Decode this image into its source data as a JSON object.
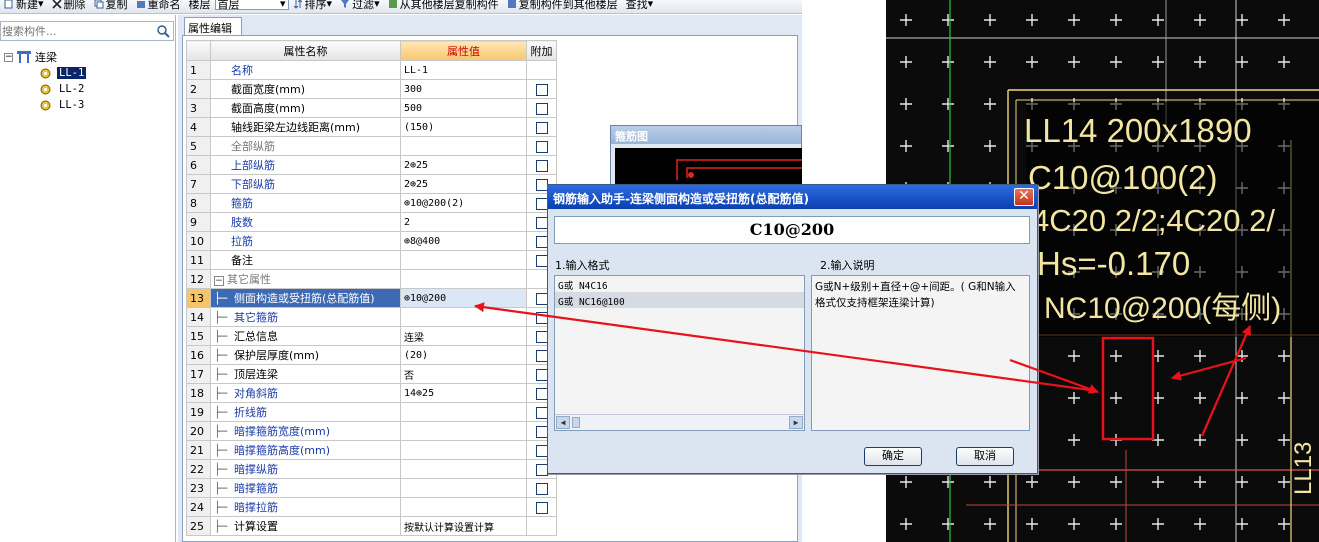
{
  "toolbar": {
    "new_label": "新建",
    "delete_label": "删除",
    "copy_label": "复制",
    "rename_label": "重命名",
    "floor_label": "楼层",
    "floor_value": "首层",
    "sort_label": "排序",
    "filter_label": "过滤",
    "copy_from_floor_label": "从其他楼层复制构件",
    "copy_to_floor_label": "复制构件到其他楼层",
    "find_label": "查找"
  },
  "search": {
    "placeholder": "搜索构件..."
  },
  "tree": {
    "root_label": "连梁",
    "children": [
      {
        "label": "LL-1"
      },
      {
        "label": "LL-2"
      },
      {
        "label": "LL-3"
      }
    ]
  },
  "property_panel": {
    "tab_label": "属性编辑",
    "headers": {
      "name": "属性名称",
      "value": "属性值",
      "extra": "附加"
    },
    "rows": [
      {
        "num": "1",
        "name": "名称",
        "value": "LL-1"
      },
      {
        "num": "2",
        "name": "截面宽度(mm)",
        "value": "300"
      },
      {
        "num": "3",
        "name": "截面高度(mm)",
        "value": "500"
      },
      {
        "num": "4",
        "name": "轴线距梁左边线距离(mm)",
        "value": "(150)"
      },
      {
        "num": "5",
        "name": "全部纵筋",
        "value": ""
      },
      {
        "num": "6",
        "name": "上部纵筋",
        "value": "2⊕25"
      },
      {
        "num": "7",
        "name": "下部纵筋",
        "value": "2⊕25"
      },
      {
        "num": "8",
        "name": "箍筋",
        "value": "⊕10@200(2)"
      },
      {
        "num": "9",
        "name": "肢数",
        "value": "2"
      },
      {
        "num": "10",
        "name": "拉筋",
        "value": "⊕8@400"
      },
      {
        "num": "11",
        "name": "备注",
        "value": ""
      },
      {
        "num": "12",
        "name": "其它属性",
        "value": ""
      },
      {
        "num": "13",
        "name": "侧面构造或受扭筋(总配筋值)",
        "value": "⊕10@200"
      },
      {
        "num": "14",
        "name": "其它箍筋",
        "value": ""
      },
      {
        "num": "15",
        "name": "汇总信息",
        "value": "连梁"
      },
      {
        "num": "16",
        "name": "保护层厚度(mm)",
        "value": "(20)"
      },
      {
        "num": "17",
        "name": "顶层连梁",
        "value": "否"
      },
      {
        "num": "18",
        "name": "对角斜筋",
        "value": "14⊕25"
      },
      {
        "num": "19",
        "name": "折线筋",
        "value": ""
      },
      {
        "num": "20",
        "name": "暗撑箍筋宽度(mm)",
        "value": ""
      },
      {
        "num": "21",
        "name": "暗撑箍筋高度(mm)",
        "value": ""
      },
      {
        "num": "22",
        "name": "暗撑纵筋",
        "value": ""
      },
      {
        "num": "23",
        "name": "暗撑箍筋",
        "value": ""
      },
      {
        "num": "24",
        "name": "暗撑拉筋",
        "value": ""
      },
      {
        "num": "25",
        "name": "计算设置",
        "value": "按默认计算设置计算"
      }
    ]
  },
  "stirrup_window": {
    "title": "箍筋图"
  },
  "dialog": {
    "title": "钢筋输入助手-连梁侧面构造或受扭筋(总配筋值)",
    "input_value": "C10@200",
    "format_label": "1.输入格式",
    "description_label": "2.输入说明",
    "formats": [
      "G或 N4C16",
      "G或 NC16@100"
    ],
    "description": "G或N+级别+直径+@+间距。( G和N输入格式仅支持框架连梁计算)",
    "ok_label": "确定",
    "cancel_label": "取消"
  },
  "photo": {
    "line1": "LL14 200x1890",
    "line2": "C10@100(2)",
    "line3": "4C20 2/2;4C20 2/",
    "line4": "Hs=-0.170",
    "line5": "NC10@200(每侧)",
    "side_label": "LL13"
  },
  "colors": {
    "accent_red": "#e8121b",
    "photo_text": "#f3e6a3",
    "selected_row": "#3d6ab3"
  }
}
